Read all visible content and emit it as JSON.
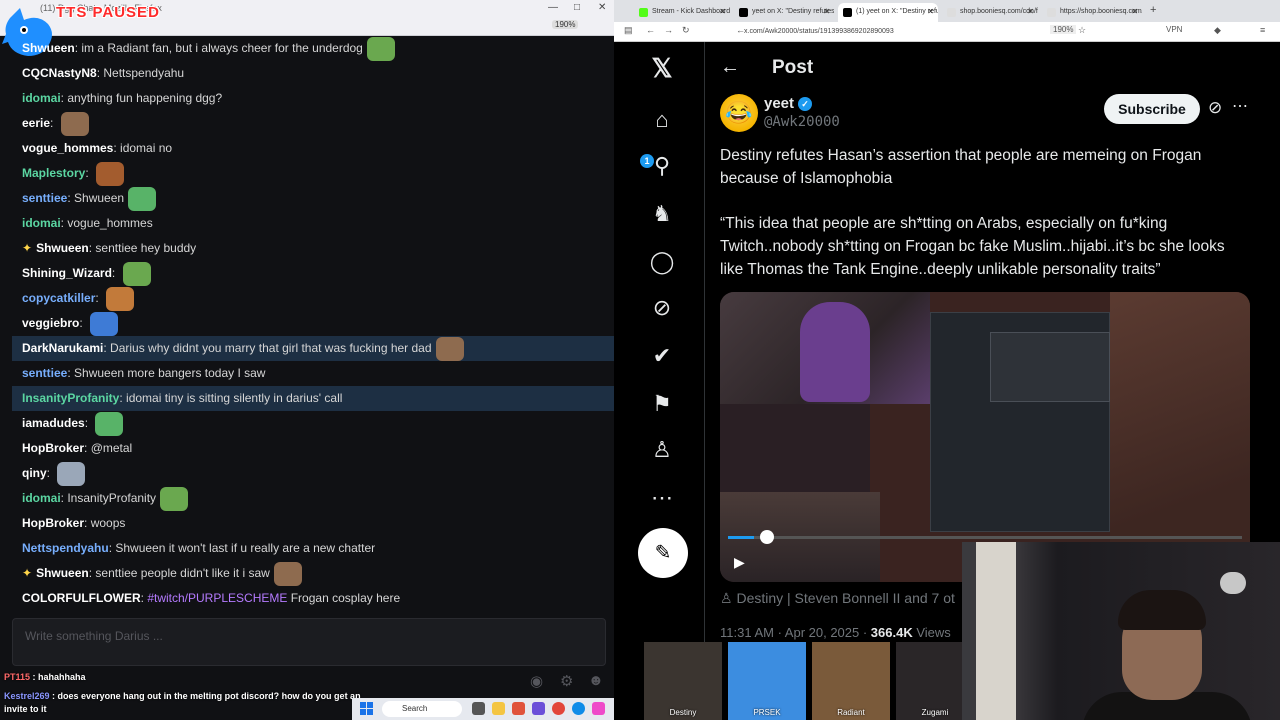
{
  "overlay": {
    "tts_status": "TTS PAUSED"
  },
  "left_window": {
    "title": "(11) Dgg Chat - Mozilla Firefox",
    "zoom": "190%",
    "chat_input_placeholder": "Write something Darius ...",
    "overlay_messages": [
      {
        "user": "PT115",
        "text": "hahahhaha"
      },
      {
        "user": "Kestrel269",
        "text": "does everyone hang out in the melting pot discord? how do you get an invite to it"
      }
    ]
  },
  "chat": {
    "messages": [
      {
        "user": "Shwueen",
        "text": "im a Radiant fan, but i always cheer for the underdog",
        "color": "white",
        "highlight": false
      },
      {
        "user": "CQCNastyN8",
        "text": "Nettspendyahu",
        "color": "white",
        "highlight": false
      },
      {
        "user": "idomai",
        "text": "anything fun happening dgg?",
        "color": "green",
        "highlight": false
      },
      {
        "user": "eerie",
        "text": "",
        "color": "white",
        "highlight": false
      },
      {
        "user": "vogue_hommes",
        "text": "idomai no",
        "color": "white",
        "highlight": false
      },
      {
        "user": "Maplestory",
        "text": "",
        "color": "green",
        "highlight": false
      },
      {
        "user": "senttiee",
        "text": "Shwueen",
        "color": "blue",
        "highlight": false
      },
      {
        "user": "idomai",
        "text": "vogue_hommes",
        "color": "green",
        "highlight": false
      },
      {
        "user": "Shwueen",
        "text": "senttiee      hey buddy",
        "color": "white",
        "highlight": false,
        "star": true
      },
      {
        "user": "Shining_Wizard",
        "text": "",
        "color": "white",
        "highlight": false
      },
      {
        "user": "copycatkiller",
        "text": "",
        "color": "blue",
        "highlight": false
      },
      {
        "user": "veggiebro",
        "text": "",
        "color": "white",
        "highlight": false
      },
      {
        "user": "DarkNarukami",
        "text": "Darius why didnt you marry that girl that was fucking her dad",
        "color": "white",
        "highlight": true
      },
      {
        "user": "senttiee",
        "text": "Shwueen more bangers today I saw",
        "color": "blue",
        "highlight": false
      },
      {
        "user": "InsanityProfanity",
        "text": "idomai tiny is sitting silently in darius' call",
        "color": "green",
        "highlight": true
      },
      {
        "user": "iamadudes",
        "text": "",
        "color": "white",
        "highlight": false
      },
      {
        "user": "HopBroker",
        "text": "@metal",
        "color": "white",
        "highlight": false
      },
      {
        "user": "qiny",
        "text": "",
        "color": "white",
        "highlight": false
      },
      {
        "user": "idomai",
        "text": "InsanityProfanity",
        "color": "green",
        "highlight": false
      },
      {
        "user": "HopBroker",
        "text": "woops",
        "color": "white",
        "highlight": false
      },
      {
        "user": "Nettspendyahu",
        "text": "Shwueen it won't last if u really are a new chatter",
        "color": "blue",
        "highlight": false
      },
      {
        "user": "Shwueen",
        "text": "senttiee      people didn't like it i saw",
        "color": "white",
        "highlight": false,
        "star": true
      },
      {
        "user": "COLORFULFLOWER",
        "text": "Frogan cosplay here",
        "tag": "#twitch/PURPLESCHEME",
        "color": "white",
        "highlight": false
      }
    ]
  },
  "taskbar": {
    "search_label": "Search"
  },
  "browser": {
    "tabs": [
      {
        "label": "Stream - Kick Dashboard",
        "fav": "#53fc18"
      },
      {
        "label": "yeet on X: \"Destiny refutes H",
        "fav": "#000000"
      },
      {
        "label": "(1) yeet on X: \"Destiny refuts",
        "fav": "#000000",
        "active": true
      },
      {
        "label": "shop.booniesq.com/cdn/fonts",
        "fav": "#dddddd"
      },
      {
        "label": "https://shop.booniesq.com/p",
        "fav": "#dddddd"
      }
    ],
    "url": "x.com/Awk20000/status/1913993869202890093",
    "zoom": "190%",
    "vpn": "VPN"
  },
  "x_app": {
    "notification_count": "1",
    "header_title": "Post",
    "author_name": "yeet",
    "author_handle": "@Awk20000",
    "subscribe_label": "Subscribe",
    "post_text_1": "Destiny refutes Hasan’s assertion that people are memeing on Frogan because of Islamophobia",
    "post_text_2": "“This idea that people are sh*tting on Arabs, especially on fu*king Twitch..nobody sh*tting on Frogan bc fake Muslim..hijabi..it’s bc she looks like Thomas the Tank Engine..deeply unlikable personality traits”",
    "video_progress": 0.05,
    "attribution": "Destiny | Steven Bonnell II and 7 ot",
    "timestamp": "11:31 AM · Apr 20, 2025 · ",
    "views_count": "366.4K",
    "views_label": " Views"
  },
  "participants": [
    {
      "name": "Destiny",
      "color": "#3b3530"
    },
    {
      "name": "PRSEK",
      "color": "#3c8de0"
    },
    {
      "name": "Radiant",
      "color": "#7a5a3a"
    },
    {
      "name": "Zugami",
      "color": "#2a2628"
    }
  ],
  "colors": {
    "accent": "#1d9bf0",
    "chat_highlight": "#1d2f43",
    "chat_bg": "#101114"
  }
}
